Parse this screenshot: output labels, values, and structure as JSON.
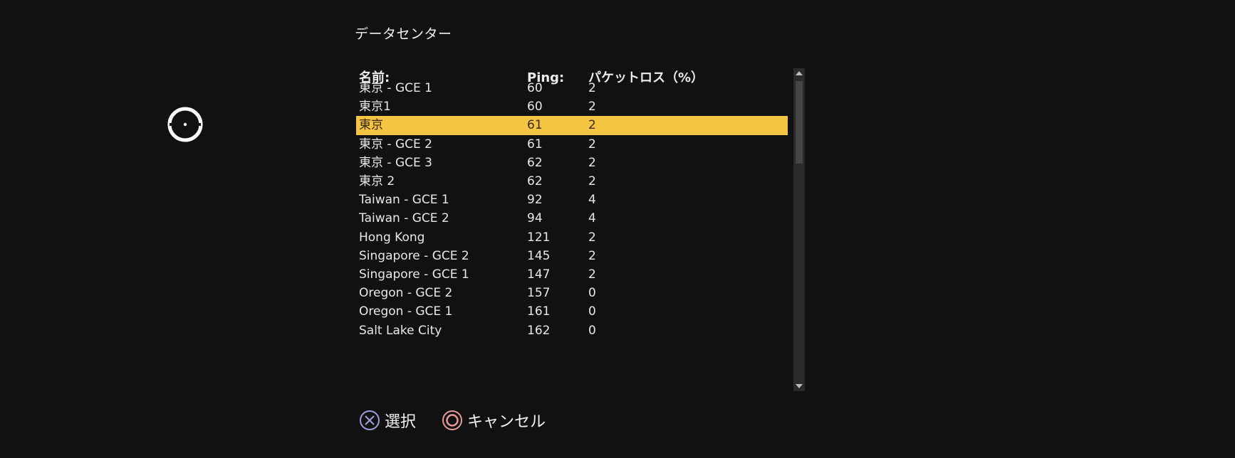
{
  "screen": {
    "title": "データセンター"
  },
  "table": {
    "headers": {
      "name": "名前:",
      "ping": "Ping:",
      "loss": "パケットロス（%）"
    },
    "rows": [
      {
        "name": "東京 - GCE 1",
        "ping": "60",
        "loss": "2"
      },
      {
        "name": "東京1",
        "ping": "60",
        "loss": "2"
      },
      {
        "name": "東京",
        "ping": "61",
        "loss": "2"
      },
      {
        "name": "東京 - GCE 2",
        "ping": "61",
        "loss": "2"
      },
      {
        "name": "東京 - GCE 3",
        "ping": "62",
        "loss": "2"
      },
      {
        "name": "東京 2",
        "ping": "62",
        "loss": "2"
      },
      {
        "name": "Taiwan - GCE 1",
        "ping": "92",
        "loss": "4"
      },
      {
        "name": "Taiwan - GCE 2",
        "ping": "94",
        "loss": "4"
      },
      {
        "name": "Hong Kong",
        "ping": "121",
        "loss": "2"
      },
      {
        "name": "Singapore - GCE 2",
        "ping": "145",
        "loss": "2"
      },
      {
        "name": "Singapore - GCE 1",
        "ping": "147",
        "loss": "2"
      },
      {
        "name": "Oregon - GCE 2",
        "ping": "157",
        "loss": "0"
      },
      {
        "name": "Oregon - GCE 1",
        "ping": "161",
        "loss": "0"
      },
      {
        "name": "Salt Lake City",
        "ping": "162",
        "loss": "0"
      }
    ],
    "selected_index": 2
  },
  "footer": {
    "select_label": "選択",
    "select_icon": "cross-button-icon",
    "cancel_label": "キャンセル",
    "cancel_icon": "circle-button-icon"
  },
  "colors": {
    "background": "#121112",
    "highlight": "#f4c443",
    "cross_icon": "#9aa0d8",
    "circle_icon": "#e79a9a"
  },
  "scroll": {
    "thumb_fraction": 0.27,
    "position": 0.0
  }
}
